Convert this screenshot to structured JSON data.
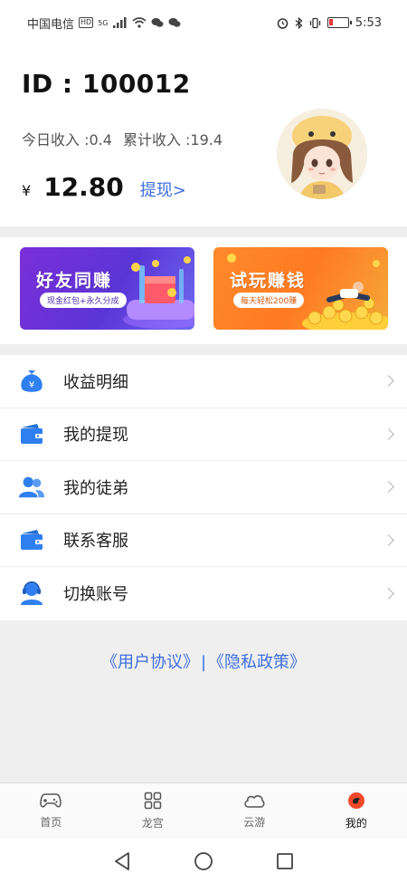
{
  "status_bar": {
    "carrier": "中国电信",
    "hd": "HD",
    "net": "5G",
    "time": "5:53"
  },
  "profile": {
    "id_text": "ID : 100012",
    "today_income": "今日收入 :0.4",
    "total_income": "累计收入 :19.4",
    "currency": "¥",
    "balance": "12.80",
    "withdraw_link": "提现>"
  },
  "banners": [
    {
      "title": "好友同赚",
      "subtitle": "现金红包+永久分成",
      "color": "#6a32d8"
    },
    {
      "title": "试玩赚钱",
      "subtitle": "每天轻松200赚",
      "color": "#ff8a2a"
    }
  ],
  "menu": {
    "items": [
      {
        "label": "收益明细",
        "icon": "money-bag-icon"
      },
      {
        "label": "我的提现",
        "icon": "wallet-icon"
      },
      {
        "label": "我的徒弟",
        "icon": "users-icon"
      },
      {
        "label": "联系客服",
        "icon": "wallet-icon"
      },
      {
        "label": "切换账号",
        "icon": "support-agent-icon"
      }
    ]
  },
  "agreement": {
    "user_agreement": "《用户协议》",
    "separator": "|",
    "privacy_policy": "《隐私政策》"
  },
  "tabs": [
    {
      "label": "首页",
      "icon": "gamepad-icon"
    },
    {
      "label": "龙宫",
      "icon": "grid-icon"
    },
    {
      "label": "云游",
      "icon": "cloud-icon"
    },
    {
      "label": "我的",
      "icon": "profile-icon",
      "active": true
    }
  ],
  "colors": {
    "accent": "#3d6ee0",
    "icon_blue": "#2f7ff0",
    "active_tab": "#f04a2a"
  }
}
